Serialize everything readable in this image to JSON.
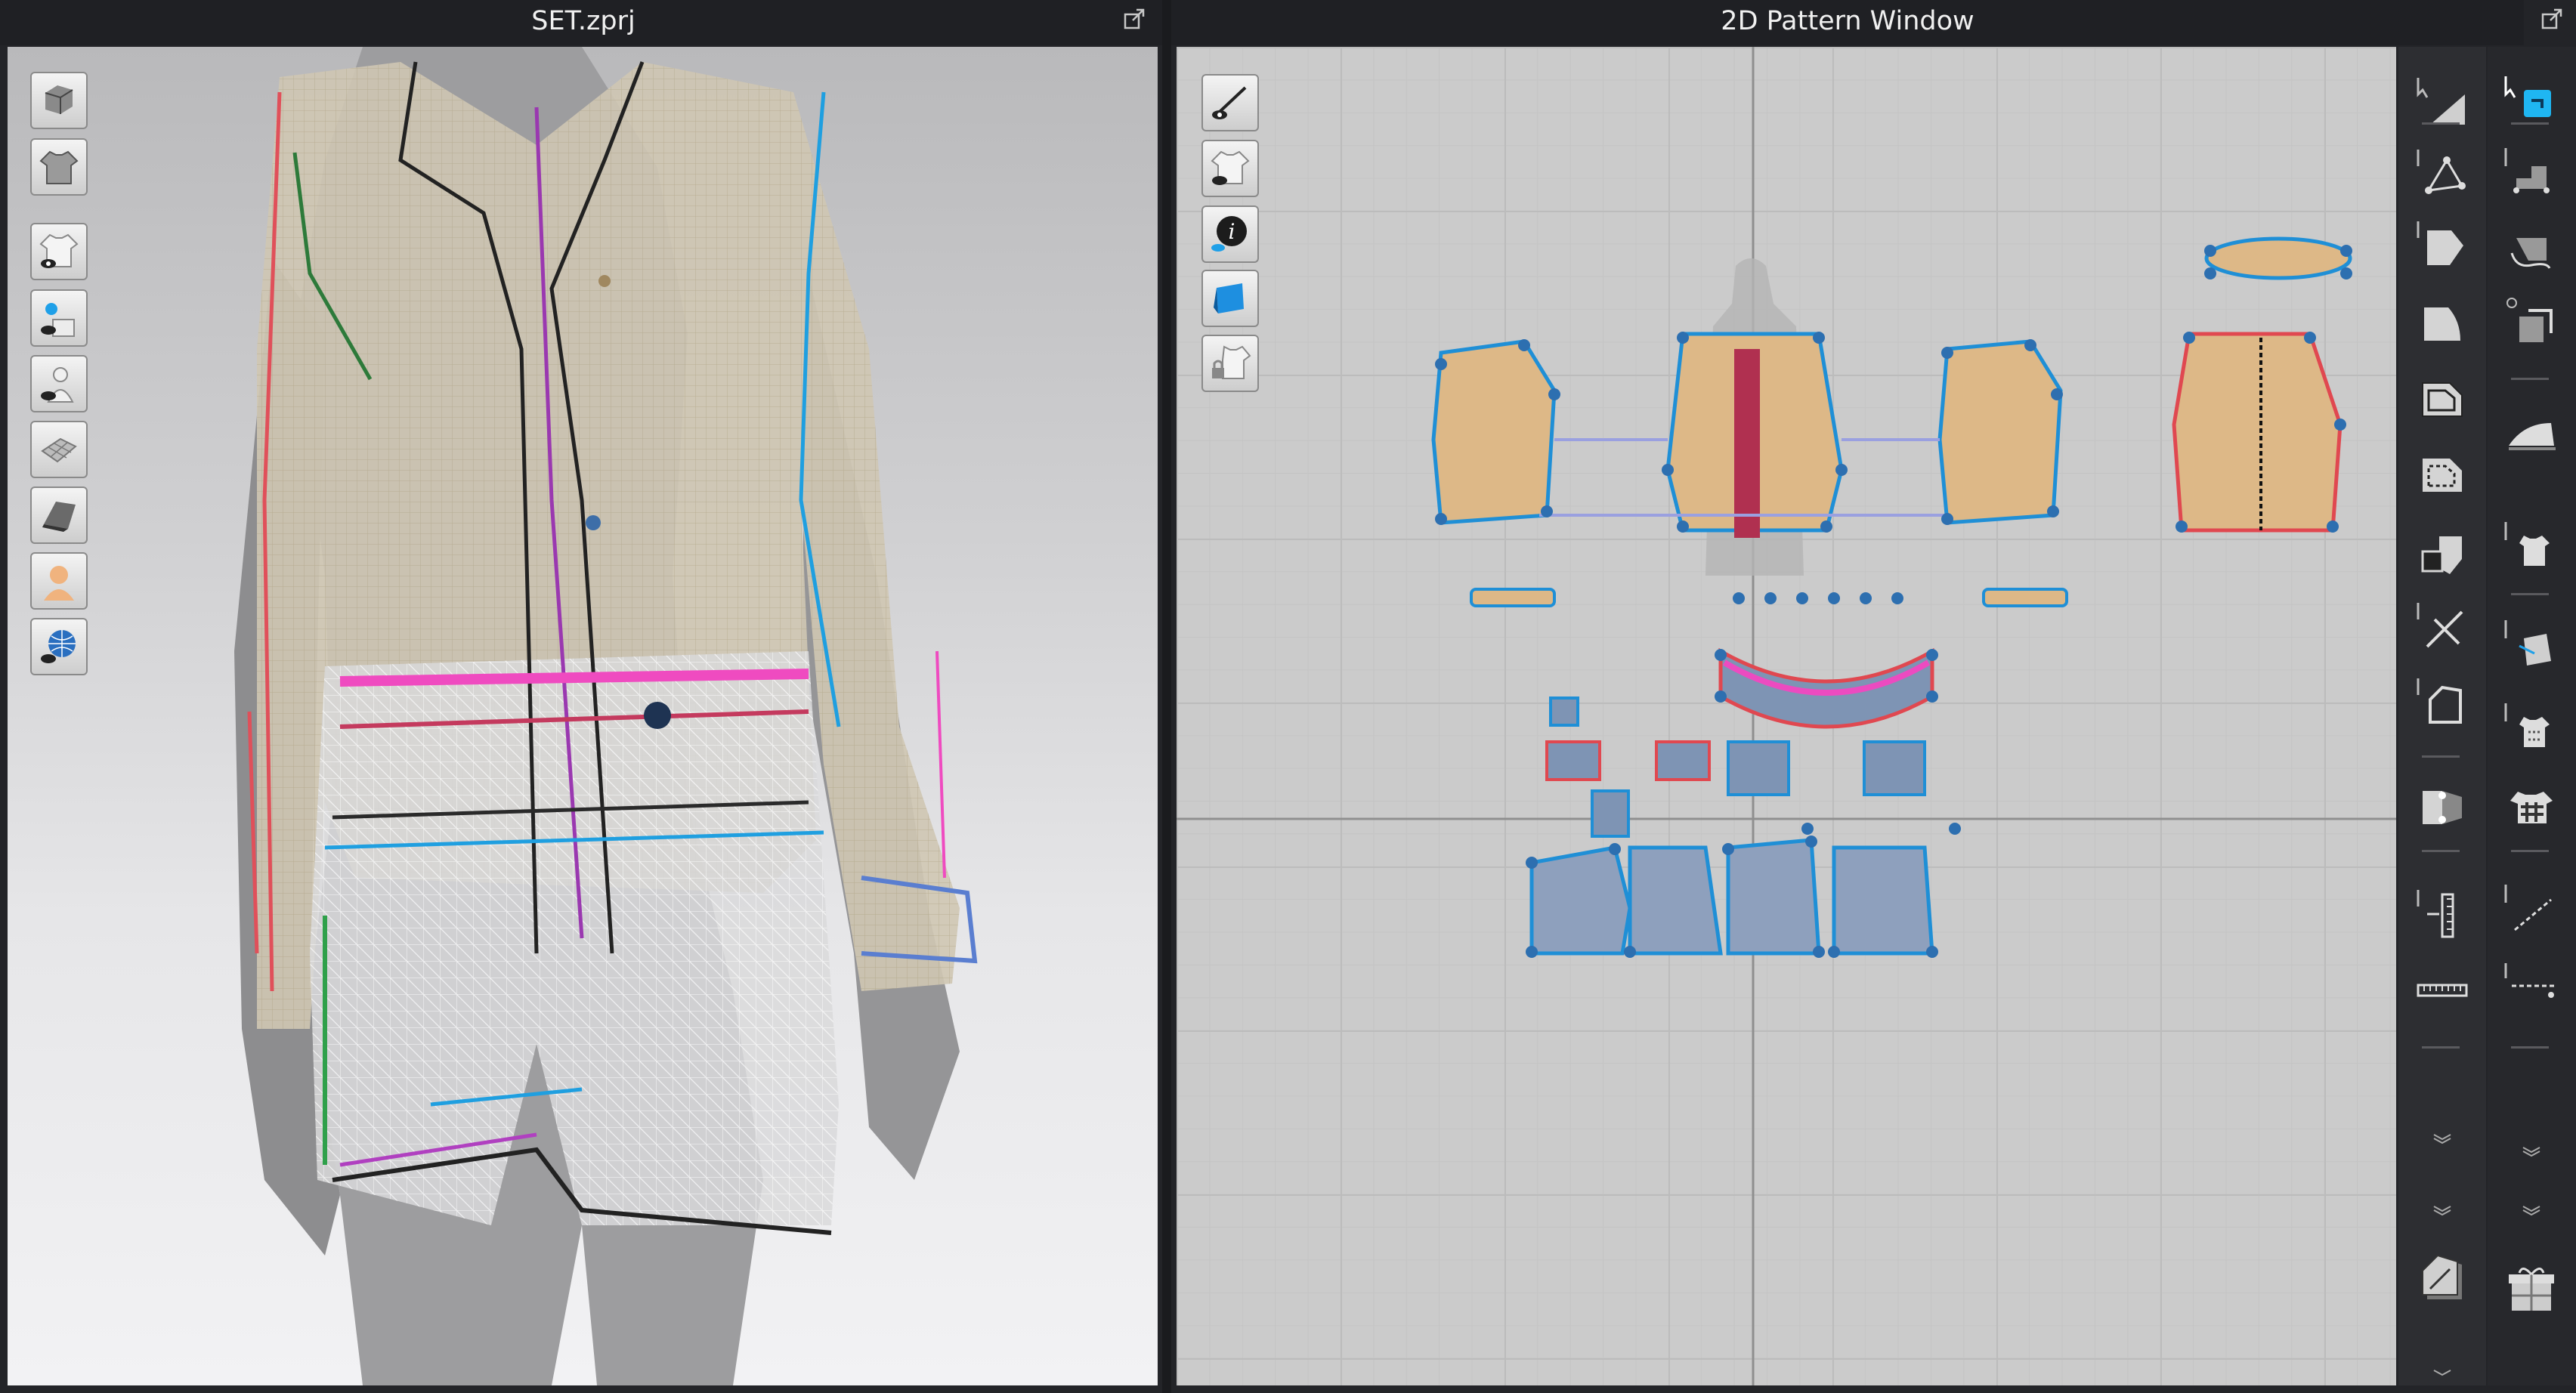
{
  "window_3d": {
    "title": "SET.zprj"
  },
  "window_2d": {
    "title": "2D Pattern Window"
  },
  "toolbar_3d": [
    {
      "icon": "avatar-display-icon"
    },
    {
      "icon": "garment-display-icon"
    },
    {
      "icon": "show-garment-icon"
    },
    {
      "icon": "show-pins-icon"
    },
    {
      "icon": "show-avatar-icon"
    },
    {
      "icon": "texture-surface-icon"
    },
    {
      "icon": "thick-surface-icon"
    },
    {
      "icon": "avatar-skin-icon"
    },
    {
      "icon": "environment-globe-icon"
    }
  ],
  "toolbar_2d": [
    {
      "icon": "show-pattern-outline-icon"
    },
    {
      "icon": "show-pattern-garment-icon"
    },
    {
      "icon": "pattern-info-icon"
    },
    {
      "icon": "fabric-texture-icon"
    },
    {
      "icon": "lock-pattern-icon"
    }
  ],
  "rail_left_icons": [
    "transform-pattern-icon",
    "edit-point-icon",
    "edit-curve-icon",
    "polygon-icon",
    "rectangle-icon",
    "internal-rectangle-icon",
    "dart-icon",
    "cut-line-icon",
    "trace-icon",
    "fold-arrangement-icon",
    "segment-sewing-icon",
    "tape-measure-icon",
    "double-chevron-icon",
    "double-chevron-icon",
    "pattern-grading-icon"
  ],
  "rail_right_icons": [
    "select-move-icon",
    "sewing-edit-icon",
    "free-sewing-icon",
    "m-n-sewing-icon",
    "iron-icon",
    "fold-garment-icon",
    "tack-icon",
    "stitch-icon",
    "pin-icon",
    "topstitch-icon",
    "line-edit-icon",
    "double-chevron-icon",
    "double-chevron-icon",
    "gift-box-icon"
  ],
  "colors": {
    "window_bg": "#232428",
    "title_text": "#f0f0f0",
    "grid_bg": "#cbcbcb",
    "axis": "#8f8f8f",
    "pattern_fill": "#ddb887",
    "denim_fill": "#7e94b4",
    "seam_blue": "#1f8fd6",
    "seam_red": "#e04850",
    "seam_pink": "#ec4bc0",
    "seam_green": "#2fa04a",
    "point_blue": "#2d6fb0",
    "active_tool": "#1fb6f2"
  }
}
